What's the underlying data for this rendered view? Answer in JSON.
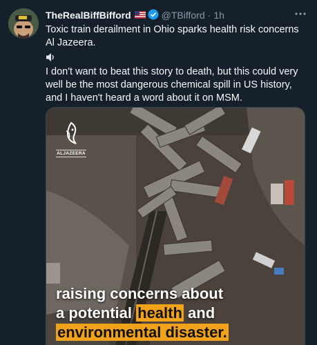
{
  "user": {
    "display_name": "TheRealBiffBifford",
    "flag_icon": "us-flag-icon",
    "verified_icon": "verified-badge-icon",
    "handle": "@TBifford",
    "separator": "·",
    "time": "1h"
  },
  "more_icon": "more-dots-icon",
  "tweet": {
    "line1": "Toxic train derailment in Ohio sparks health risk concerns Al Jazeera.",
    "speaker_icon": "speaker-icon",
    "line2": "I don't want to beat this story to death, but this could very well be the most dangerous chemical spill in US history, and I haven't heard a word about it on MSM."
  },
  "media": {
    "logo_text": "ALJAZEERA",
    "caption_line1": "raising concerns about",
    "caption_line2_pre": "a potential ",
    "caption_line2_highlight": "health",
    "caption_line2_post": " and",
    "caption_line3_highlight": "environmental disaster."
  },
  "colors": {
    "background": "#15202b",
    "text": "#f7f9f9",
    "secondary_text": "#8b98a5",
    "verified": "#1d9bf0",
    "caption_highlight": "#f0a21a"
  }
}
